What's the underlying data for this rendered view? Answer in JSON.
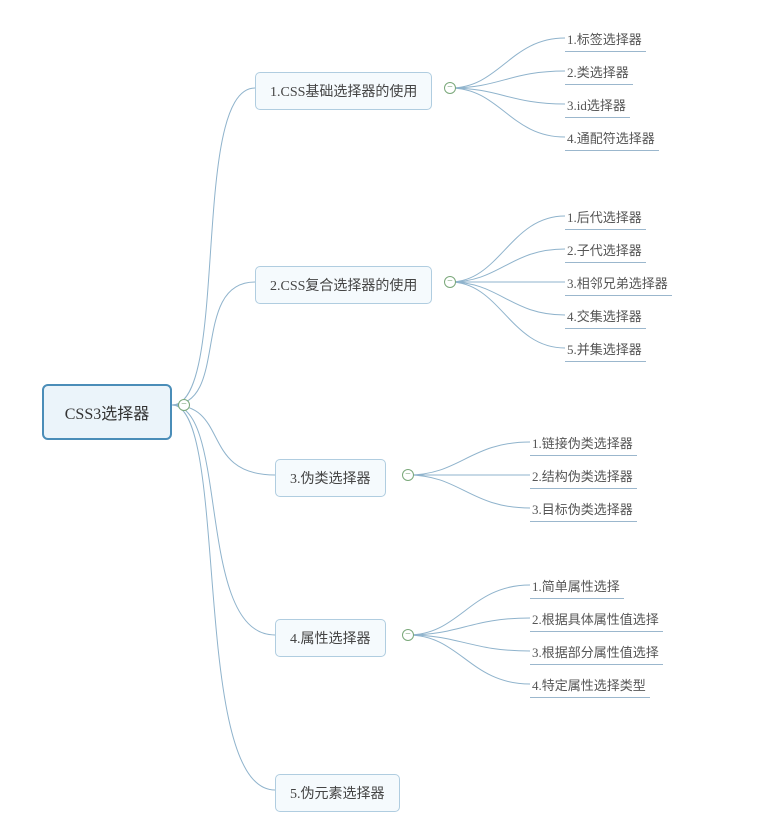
{
  "root": {
    "label": "CSS3选择器"
  },
  "branches": [
    {
      "label": "1.CSS基础选择器的使用",
      "leaves": [
        "1.标签选择器",
        "2.类选择器",
        "3.id选择器",
        "4.通配符选择器"
      ]
    },
    {
      "label": "2.CSS复合选择器的使用",
      "leaves": [
        "1.后代选择器",
        "2.子代选择器",
        "3.相邻兄弟选择器",
        "4.交集选择器",
        "5.并集选择器"
      ]
    },
    {
      "label": "3.伪类选择器",
      "leaves": [
        "1.链接伪类选择器",
        "2.结构伪类选择器",
        "3.目标伪类选择器"
      ]
    },
    {
      "label": "4.属性选择器",
      "leaves": [
        "1.简单属性选择",
        "2.根据具体属性值选择",
        "3.根据部分属性值选择",
        "4.特定属性选择类型"
      ]
    },
    {
      "label": "5.伪元素选择器",
      "leaves": []
    }
  ]
}
